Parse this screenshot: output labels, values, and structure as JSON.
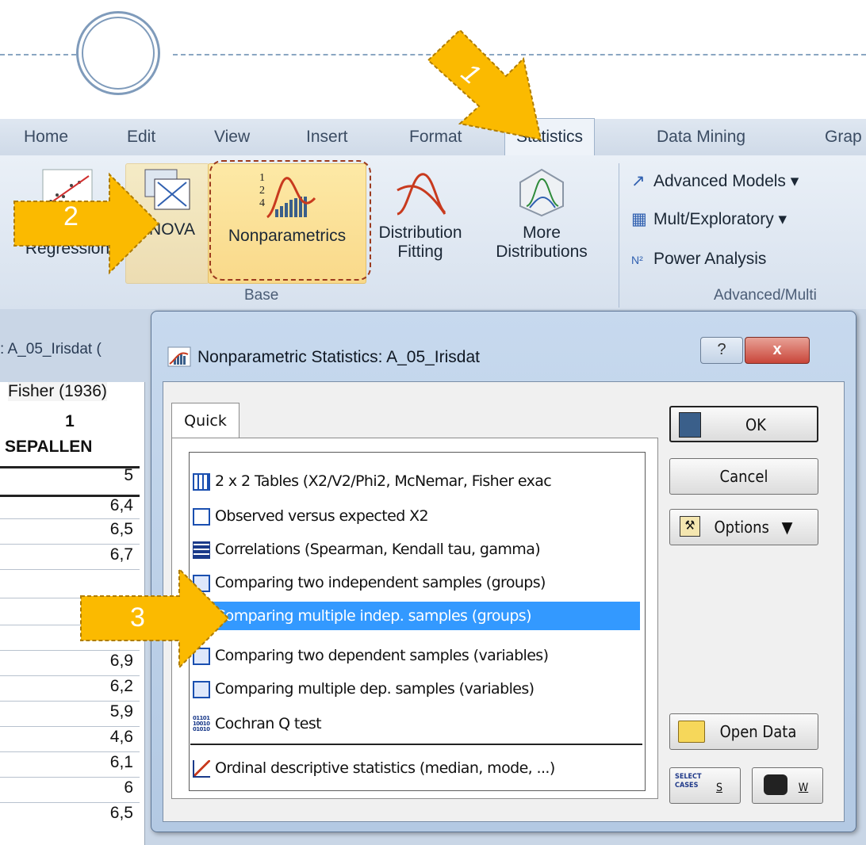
{
  "ribbon": {
    "tabs": [
      "Home",
      "Edit",
      "View",
      "Insert",
      "Format",
      "Statistics",
      "Data Mining",
      "Grap"
    ],
    "buttons": {
      "multiple_regression": "Multiple Regression",
      "anova": "ANOVA",
      "nonparametrics": "Nonparametrics",
      "distribution_fitting": "Distribution Fitting",
      "more_distributions": "More Distributions"
    },
    "base_group_label": "Base",
    "advanced": {
      "advanced_models": "Advanced Models",
      "mult_exploratory": "Mult/Exploratory",
      "power_analysis": "Power Analysis",
      "group_label": "Advanced/Multi"
    }
  },
  "workbook": {
    "title": ": A_05_Irisdat (",
    "subtitle": "Fisher (1936)",
    "column_number": "1",
    "column_name": "SEPALLEN",
    "values": [
      "5",
      "6,4",
      "6,5",
      "6,7",
      "",
      "",
      "6,9",
      "6,2",
      "5,9",
      "4,6",
      "6,1",
      "6",
      "6,5"
    ]
  },
  "dialog": {
    "title": "Nonparametric Statistics: A_05_Irisdat",
    "help_glyph": "?",
    "close_glyph": "x",
    "tab_label": "Quick",
    "items": [
      "2 x 2 Tables (X2/V2/Phi2, McNemar, Fisher exac",
      "Observed versus expected X2",
      "Correlations (Spearman, Kendall tau, gamma)",
      "Comparing two independent samples (groups)",
      "Comparing multiple indep. samples (groups)",
      "Comparing two dependent samples (variables)",
      "Comparing multiple dep. samples (variables)",
      "Cochran Q test",
      "Ordinal descriptive statistics (median, mode, ...)"
    ],
    "selected_index": 4,
    "buttons": {
      "ok": "OK",
      "cancel": "Cancel",
      "options": "Options",
      "open_data": "Open Data",
      "select_cases_icon_text": "SELECT CASES",
      "select_cases_key": "S",
      "weight_key": "W"
    }
  },
  "annotations": {
    "arrow1": "1",
    "arrow2": "2",
    "arrow3": "3"
  }
}
